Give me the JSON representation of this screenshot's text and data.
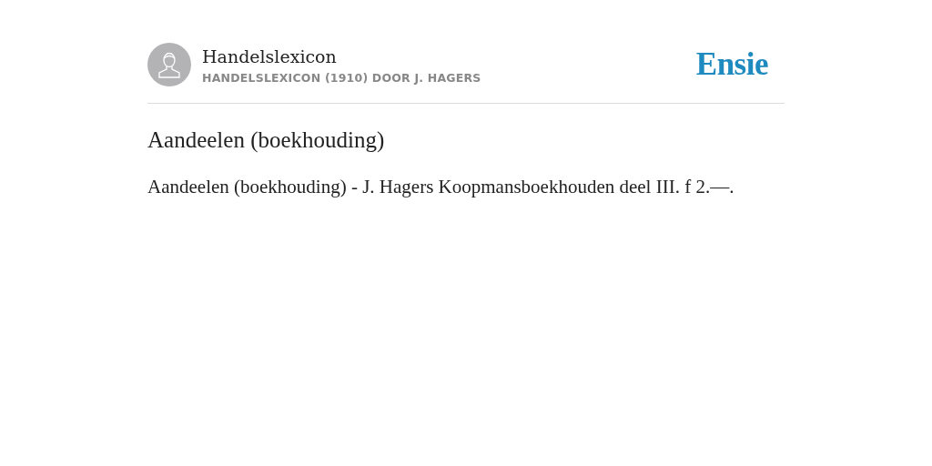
{
  "header": {
    "source_title": "Handelslexicon",
    "source_subtitle": "HANDELSLEXICON (1910) DOOR J. HAGERS",
    "logo": "Ensie"
  },
  "article": {
    "title": "Aandeelen (boekhouding)",
    "body": "Aandeelen (boekhouding) - J. Hagers Koopmansboekhouden deel III. f 2.—."
  }
}
